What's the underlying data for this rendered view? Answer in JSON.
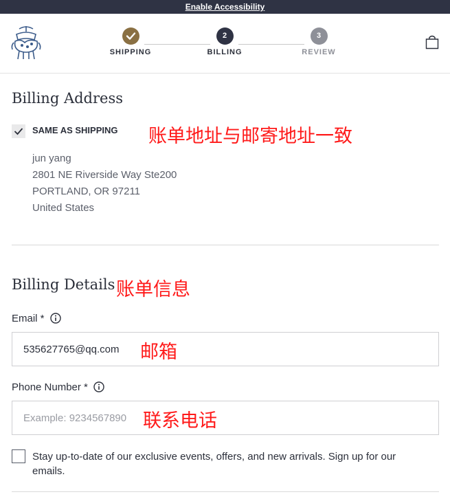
{
  "accessibility": {
    "link_label": "Enable Accessibility"
  },
  "steps": [
    {
      "number": "✓",
      "label": "SHIPPING"
    },
    {
      "number": "2",
      "label": "BILLING"
    },
    {
      "number": "3",
      "label": "REVIEW"
    }
  ],
  "billing_address": {
    "title": "Billing Address",
    "same_as_shipping_label": "SAME AS SHIPPING",
    "same_as_shipping_checked": true,
    "annotation": "账单地址与邮寄地址一致",
    "address_lines": [
      "jun yang",
      "2801 NE Riverside Way Ste200",
      "PORTLAND, OR 97211",
      "United States"
    ]
  },
  "billing_details": {
    "title": "Billing Details",
    "annotation": "账单信息",
    "email": {
      "label": "Email *",
      "value": "535627765@qq.com",
      "annotation": "邮箱"
    },
    "phone": {
      "label": "Phone Number *",
      "placeholder": "Example: 9234567890",
      "value": "",
      "annotation": "联系电话"
    },
    "newsletter": {
      "label": "Stay up-to-date of our exclusive events, offers, and new arrivals. Sign up for our emails.",
      "checked": false
    }
  },
  "colors": {
    "step_done": "#8a7043",
    "step_active": "#2f3344",
    "step_pending": "#8e9098",
    "annotation": "#ff1a1a",
    "top_bar": "#2f3344"
  },
  "icons": {
    "logo": "golden-fleece-logo",
    "cart": "shopping-bag-icon",
    "info": "info-icon",
    "check": "checkmark-icon"
  }
}
